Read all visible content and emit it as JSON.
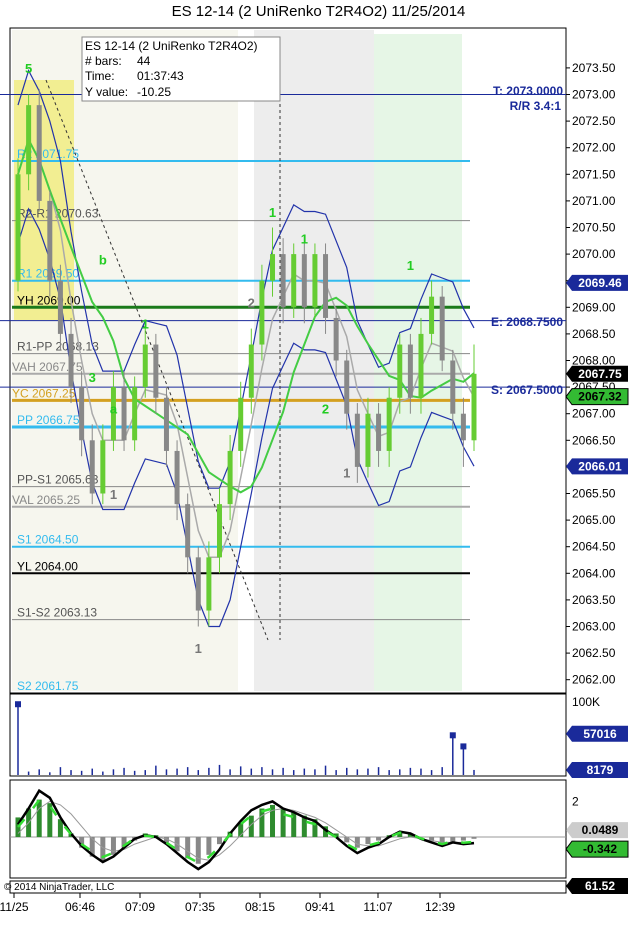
{
  "window": {
    "title": "ES 12-14 (2 UniRenko T2R4O2)  11/25/2014",
    "copyright": "© 2014 NinjaTrader, LLC"
  },
  "data_box": {
    "line1": "ES 12-14 (2 UniRenko T2R4O2)",
    "line2_label": "# bars:",
    "line2_value": "44",
    "line3_label": "Time:",
    "line3_value": "01:37:43",
    "line4_label": "Y value:",
    "line4_value": "-10.25"
  },
  "trade": {
    "target": "T: 2073.0000",
    "rr": "R/R 3.4:1",
    "entry": "E: 2068.7500",
    "stop": "S: 2067.5000"
  },
  "colors": {
    "pivot_cyan": "#33bbee",
    "yh_green": "#1a7a1a",
    "yc_orange": "#d4a020",
    "axis_blue": "#1a2a9a",
    "up_bar": "#66cc33",
    "down_bar": "#888888",
    "badge_green": "#33bb33"
  },
  "chart_data": [
    {
      "type": "bar",
      "panel": "price",
      "ylim": [
        2061.75,
        2074.25
      ],
      "yticks": [
        "2073.50",
        "2073.00",
        "2072.50",
        "2072.00",
        "2071.50",
        "2071.00",
        "2070.50",
        "2070.00",
        "2069.50",
        "2069.00",
        "2068.50",
        "2068.00",
        "2067.50",
        "2067.00",
        "2066.50",
        "2066.00",
        "2065.50",
        "2065.00",
        "2064.50",
        "2064.00",
        "2063.50",
        "2063.00",
        "2062.50",
        "2062.00"
      ],
      "x_labels": [
        "11/25",
        "06:46",
        "07:09",
        "07:35",
        "08:15",
        "09:41",
        "11:07",
        "12:39"
      ],
      "bar_count": 44,
      "badges": [
        {
          "text": "2069.46",
          "value": 2069.46,
          "style": "blue"
        },
        {
          "text": "2067.75",
          "value": 2067.75,
          "style": "black"
        },
        {
          "text": "2067.32",
          "value": 2067.32,
          "style": "green"
        },
        {
          "text": "2066.01",
          "value": 2066.01,
          "style": "blue"
        }
      ],
      "levels": [
        {
          "label": "R2 2071.75",
          "value": 2071.75,
          "kind": "pivot"
        },
        {
          "label": "R2-R1 2070.63",
          "value": 2070.63,
          "kind": "mid"
        },
        {
          "label": "R1 2069.50",
          "value": 2069.5,
          "kind": "pivot"
        },
        {
          "label": "YH 2069.00",
          "value": 2069.0,
          "kind": "yh"
        },
        {
          "label": "R1-PP 2068.13",
          "value": 2068.13,
          "kind": "mid"
        },
        {
          "label": "VAH 2067.75",
          "value": 2067.75,
          "kind": "va"
        },
        {
          "label": "YC 2067.25",
          "value": 2067.25,
          "kind": "yc"
        },
        {
          "label": "PP 2066.75",
          "value": 2066.75,
          "kind": "pp"
        },
        {
          "label": "PP-S1 2065.63",
          "value": 2065.63,
          "kind": "mid"
        },
        {
          "label": "VAL 2065.25",
          "value": 2065.25,
          "kind": "va"
        },
        {
          "label": "S1 2064.50",
          "value": 2064.5,
          "kind": "pivot"
        },
        {
          "label": "YL 2064.00",
          "value": 2064.0,
          "kind": "yl"
        },
        {
          "label": "S1-S2 2063.13",
          "value": 2063.13,
          "kind": "mid"
        },
        {
          "label": "S2 2061.75",
          "value": 2061.75,
          "kind": "pivot"
        }
      ],
      "trade_lines": [
        {
          "name": "target",
          "value": 2073.0
        },
        {
          "name": "entry",
          "value": 2068.75
        },
        {
          "name": "stop",
          "value": 2067.5
        }
      ],
      "bars": [
        {
          "o": 2069.5,
          "c": 2071.5,
          "h": 2071.8,
          "l": 2069.3
        },
        {
          "o": 2071.5,
          "c": 2072.8,
          "h": 2073.0,
          "l": 2071.2
        },
        {
          "o": 2072.8,
          "c": 2071.0,
          "h": 2073.1,
          "l": 2070.8
        },
        {
          "o": 2071.0,
          "c": 2069.5,
          "h": 2071.2,
          "l": 2069.2
        },
        {
          "o": 2069.5,
          "c": 2068.5,
          "h": 2069.8,
          "l": 2068.2
        },
        {
          "o": 2068.5,
          "c": 2067.5,
          "h": 2068.8,
          "l": 2067.2
        },
        {
          "o": 2067.5,
          "c": 2066.5,
          "h": 2067.8,
          "l": 2066.2
        },
        {
          "o": 2066.5,
          "c": 2065.5,
          "h": 2066.8,
          "l": 2065.3
        },
        {
          "o": 2065.5,
          "c": 2066.5,
          "h": 2066.8,
          "l": 2065.3
        },
        {
          "o": 2066.5,
          "c": 2067.5,
          "h": 2067.8,
          "l": 2066.3
        },
        {
          "o": 2067.5,
          "c": 2066.5,
          "h": 2067.8,
          "l": 2066.3
        },
        {
          "o": 2066.5,
          "c": 2067.5,
          "h": 2067.7,
          "l": 2066.3
        },
        {
          "o": 2067.5,
          "c": 2068.3,
          "h": 2068.7,
          "l": 2067.3
        },
        {
          "o": 2068.3,
          "c": 2067.3,
          "h": 2068.5,
          "l": 2067.0
        },
        {
          "o": 2067.3,
          "c": 2066.3,
          "h": 2067.5,
          "l": 2066.0
        },
        {
          "o": 2066.3,
          "c": 2065.3,
          "h": 2066.5,
          "l": 2065.0
        },
        {
          "o": 2065.3,
          "c": 2064.3,
          "h": 2065.5,
          "l": 2064.0
        },
        {
          "o": 2064.3,
          "c": 2063.3,
          "h": 2064.5,
          "l": 2063.0
        },
        {
          "o": 2063.3,
          "c": 2064.3,
          "h": 2064.6,
          "l": 2063.0
        },
        {
          "o": 2064.3,
          "c": 2065.3,
          "h": 2065.6,
          "l": 2064.0
        },
        {
          "o": 2065.3,
          "c": 2066.3,
          "h": 2066.6,
          "l": 2065.0
        },
        {
          "o": 2066.3,
          "c": 2067.3,
          "h": 2067.6,
          "l": 2066.0
        },
        {
          "o": 2067.3,
          "c": 2068.3,
          "h": 2068.6,
          "l": 2067.0
        },
        {
          "o": 2068.3,
          "c": 2069.5,
          "h": 2069.8,
          "l": 2068.0
        },
        {
          "o": 2069.5,
          "c": 2070.0,
          "h": 2070.5,
          "l": 2069.2
        },
        {
          "o": 2070.0,
          "c": 2069.0,
          "h": 2070.3,
          "l": 2068.7
        },
        {
          "o": 2069.0,
          "c": 2070.0,
          "h": 2070.2,
          "l": 2068.8
        },
        {
          "o": 2070.0,
          "c": 2069.0,
          "h": 2070.2,
          "l": 2068.7
        },
        {
          "o": 2069.0,
          "c": 2070.0,
          "h": 2070.2,
          "l": 2068.8
        },
        {
          "o": 2070.0,
          "c": 2068.8,
          "h": 2070.2,
          "l": 2068.5
        },
        {
          "o": 2068.8,
          "c": 2068.0,
          "h": 2069.0,
          "l": 2067.7
        },
        {
          "o": 2068.0,
          "c": 2067.0,
          "h": 2068.2,
          "l": 2066.7
        },
        {
          "o": 2067.0,
          "c": 2066.0,
          "h": 2067.2,
          "l": 2065.7
        },
        {
          "o": 2066.0,
          "c": 2067.0,
          "h": 2067.3,
          "l": 2065.8
        },
        {
          "o": 2067.0,
          "c": 2066.3,
          "h": 2067.2,
          "l": 2066.0
        },
        {
          "o": 2066.3,
          "c": 2067.3,
          "h": 2067.5,
          "l": 2066.0
        },
        {
          "o": 2067.3,
          "c": 2068.3,
          "h": 2068.5,
          "l": 2067.0
        },
        {
          "o": 2068.3,
          "c": 2067.3,
          "h": 2068.5,
          "l": 2067.0
        },
        {
          "o": 2067.3,
          "c": 2068.5,
          "h": 2068.8,
          "l": 2067.0
        },
        {
          "o": 2068.5,
          "c": 2069.2,
          "h": 2069.5,
          "l": 2068.3
        },
        {
          "o": 2069.2,
          "c": 2068.0,
          "h": 2069.4,
          "l": 2067.8
        },
        {
          "o": 2068.0,
          "c": 2067.0,
          "h": 2068.2,
          "l": 2066.7
        },
        {
          "o": 2067.0,
          "c": 2066.5,
          "h": 2067.3,
          "l": 2066.0
        },
        {
          "o": 2066.5,
          "c": 2067.75,
          "h": 2068.3,
          "l": 2066.3
        }
      ],
      "swing_labels": [
        {
          "text": "5",
          "bar": 1,
          "value": 2073.4,
          "color": "green"
        },
        {
          "text": "b",
          "bar": 8,
          "value": 2069.8,
          "color": "green"
        },
        {
          "text": "3",
          "bar": 7,
          "value": 2067.6,
          "color": "green"
        },
        {
          "text": "a",
          "bar": 9,
          "value": 2067.0,
          "color": "green"
        },
        {
          "text": "1",
          "bar": 12,
          "value": 2068.6,
          "color": "green"
        },
        {
          "text": "1",
          "bar": 9,
          "value": 2065.4,
          "color": "gray"
        },
        {
          "text": "1",
          "bar": 17,
          "value": 2062.5,
          "color": "gray"
        },
        {
          "text": "2",
          "bar": 22,
          "value": 2069.0,
          "color": "gray"
        },
        {
          "text": "1",
          "bar": 24,
          "value": 2070.7,
          "color": "green"
        },
        {
          "text": "1",
          "bar": 27,
          "value": 2070.2,
          "color": "green"
        },
        {
          "text": "2",
          "bar": 29,
          "value": 2067.0,
          "color": "green"
        },
        {
          "text": "1",
          "bar": 31,
          "value": 2065.8,
          "color": "gray"
        },
        {
          "text": "1",
          "bar": 37,
          "value": 2069.7,
          "color": "green"
        }
      ]
    },
    {
      "type": "bar",
      "panel": "volume",
      "ylim": [
        0,
        100000
      ],
      "yticks": [
        "100K"
      ],
      "badges": [
        {
          "text": "57016",
          "value": 57016,
          "style": "blue"
        },
        {
          "text": "8179",
          "value": 8179,
          "style": "blue"
        }
      ],
      "values": [
        97000,
        6000,
        9000,
        5000,
        12000,
        8000,
        7000,
        10000,
        6000,
        9000,
        11000,
        7000,
        8000,
        14000,
        9000,
        10000,
        12000,
        8000,
        11000,
        15000,
        9000,
        13000,
        10000,
        12000,
        9000,
        11000,
        8000,
        10000,
        9000,
        14000,
        8000,
        11000,
        9000,
        10000,
        12000,
        8000,
        9000,
        11000,
        10000,
        8000,
        12000,
        55000,
        40000,
        8179
      ]
    },
    {
      "type": "bar",
      "panel": "macd",
      "ylim": [
        -2.3,
        3.2
      ],
      "yticks": [
        "2"
      ],
      "badges": [
        {
          "text": "-0.342",
          "value": -0.342,
          "style": "green"
        },
        {
          "text": "0.0489",
          "value": 0.0489,
          "style": "gray"
        }
      ],
      "histogram": [
        1.1,
        1.6,
        2.1,
        1.9,
        1.0,
        0.2,
        -0.6,
        -1.1,
        -1.4,
        -1.0,
        -0.6,
        -0.2,
        0.2,
        0.1,
        -0.3,
        -0.8,
        -1.2,
        -1.5,
        -1.0,
        -0.4,
        0.3,
        0.8,
        1.2,
        1.6,
        1.8,
        1.6,
        1.4,
        1.2,
        1.0,
        0.6,
        0.2,
        -0.3,
        -0.6,
        -0.4,
        -0.2,
        0.1,
        0.3,
        0.2,
        0.0,
        -0.2,
        -0.4,
        -0.3,
        -0.2,
        -0.1
      ],
      "macd_line": [
        0.7,
        1.6,
        2.6,
        2.2,
        1.1,
        0.2,
        -0.5,
        -1.0,
        -1.4,
        -1.1,
        -0.6,
        -0.1,
        0.1,
        0.0,
        -0.4,
        -0.9,
        -1.4,
        -1.8,
        -1.4,
        -0.7,
        0.2,
        0.9,
        1.5,
        1.8,
        2.0,
        1.6,
        1.4,
        1.1,
        0.9,
        0.4,
        0.0,
        -0.5,
        -0.9,
        -0.6,
        -0.4,
        0.0,
        0.3,
        0.2,
        -0.1,
        -0.3,
        -0.5,
        -0.3,
        -0.4,
        -0.34
      ],
      "signal_line": [
        0.2,
        0.8,
        1.6,
        2.0,
        1.8,
        1.3,
        0.6,
        -0.1,
        -0.6,
        -0.8,
        -0.7,
        -0.4,
        -0.2,
        0.0,
        -0.1,
        -0.4,
        -0.8,
        -1.2,
        -1.3,
        -1.0,
        -0.5,
        0.1,
        0.7,
        1.2,
        1.5,
        1.6,
        1.5,
        1.3,
        1.1,
        0.8,
        0.4,
        0.0,
        -0.4,
        -0.5,
        -0.5,
        -0.3,
        -0.1,
        0.0,
        -0.1,
        -0.2,
        -0.3,
        -0.3,
        -0.3,
        -0.3
      ]
    },
    {
      "type": "line",
      "panel": "bottom",
      "badges": [
        {
          "text": "61.52",
          "value": 61.52,
          "style": "black"
        }
      ]
    }
  ]
}
